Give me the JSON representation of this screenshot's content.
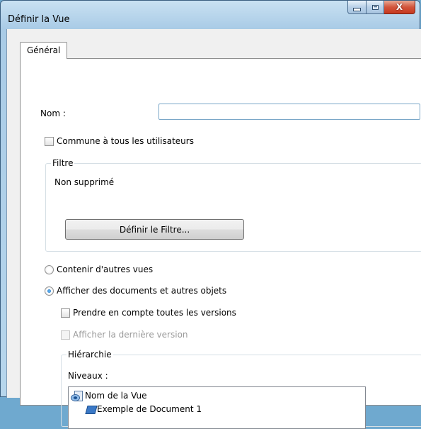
{
  "window": {
    "title": "Définir la Vue",
    "close_glyph": "X"
  },
  "tabs": [
    {
      "label": "Général"
    }
  ],
  "form": {
    "nom_label": "Nom :",
    "nom_value": "",
    "commune_label": "Commune à tous les utilisateurs",
    "commune_checked": false
  },
  "filtre": {
    "legend": "Filtre",
    "value": "Non supprimé",
    "button_label": "Définir le Filtre..."
  },
  "contenu": {
    "option_vues": "Contenir d'autres vues",
    "option_documents": "Afficher des documents et autres objets",
    "selected": "documents"
  },
  "options": {
    "toutes_versions_label": "Prendre en compte toutes les versions",
    "toutes_versions_checked": false,
    "derniere_version_label": "Afficher la dernière version",
    "derniere_version_enabled": false
  },
  "hierarchie": {
    "legend": "Hiérarchie",
    "niveaux_label": "Niveaux :",
    "items": [
      {
        "label": "Nom de la Vue",
        "icon": "view-icon"
      },
      {
        "label": "Exemple de Document 1",
        "icon": "document-icon"
      }
    ]
  }
}
